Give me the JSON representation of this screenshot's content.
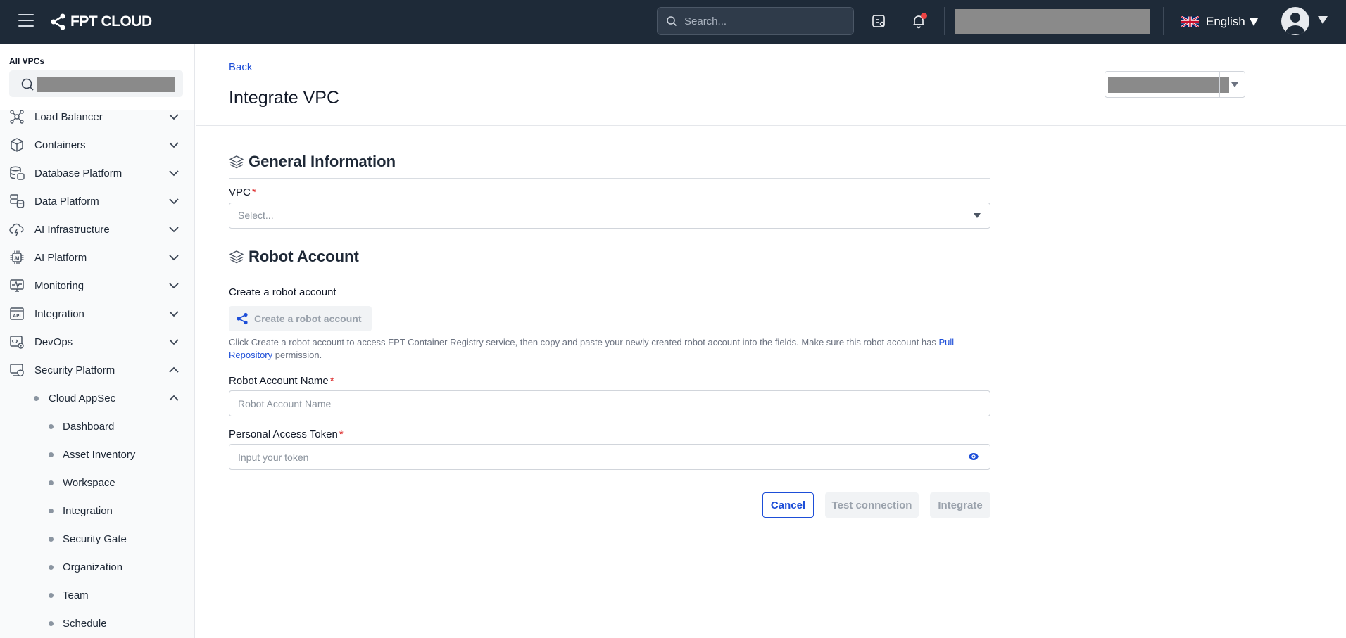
{
  "header": {
    "brand": "FPT CLOUD",
    "search_placeholder": "Search...",
    "language": "English"
  },
  "sidebar": {
    "title": "All VPCs",
    "items": [
      {
        "label": "Load Balancer",
        "icon": "load-balancer-icon",
        "expanded": false
      },
      {
        "label": "Containers",
        "icon": "cube-icon",
        "expanded": false
      },
      {
        "label": "Database Platform",
        "icon": "database-icon",
        "expanded": false
      },
      {
        "label": "Data Platform",
        "icon": "data-platform-icon",
        "expanded": false
      },
      {
        "label": "AI Infrastructure",
        "icon": "cloud-bolt-icon",
        "expanded": false
      },
      {
        "label": "AI Platform",
        "icon": "ai-chip-icon",
        "expanded": false
      },
      {
        "label": "Monitoring",
        "icon": "monitor-pulse-icon",
        "expanded": false
      },
      {
        "label": "Integration",
        "icon": "api-icon",
        "expanded": false
      },
      {
        "label": "DevOps",
        "icon": "devops-icon",
        "expanded": false
      },
      {
        "label": "Security Platform",
        "icon": "security-icon",
        "expanded": true
      }
    ],
    "sub_item": {
      "label": "Cloud AppSec",
      "expanded": true
    },
    "sub_items": [
      "Dashboard",
      "Asset Inventory",
      "Workspace",
      "Integration",
      "Security Gate",
      "Organization",
      "Team",
      "Schedule"
    ]
  },
  "main": {
    "back_label": "Back",
    "title": "Integrate VPC",
    "general": {
      "title": "General Information",
      "vpc_label": "VPC",
      "vpc_placeholder": "Select..."
    },
    "robot": {
      "title": "Robot Account",
      "create_label": "Create a robot account",
      "create_button": "Create a robot account",
      "help_prefix": "Click Create a robot account to access FPT Container Registry service, then copy and paste your newly created robot account into the fields. Make sure this robot account has ",
      "help_link": "Pull Repository",
      "help_suffix": " permission.",
      "name_label": "Robot Account Name",
      "name_placeholder": "Robot Account Name",
      "token_label": "Personal Access Token",
      "token_placeholder": "Input your token"
    },
    "required_mark": "*",
    "actions": {
      "cancel": "Cancel",
      "test": "Test connection",
      "integrate": "Integrate"
    }
  },
  "colors": {
    "header_bg": "#1e2a38",
    "link": "#1d4ed8",
    "required": "#dc2626",
    "notification_dot": "#ef4444",
    "redacted": "#8a8a8a"
  }
}
